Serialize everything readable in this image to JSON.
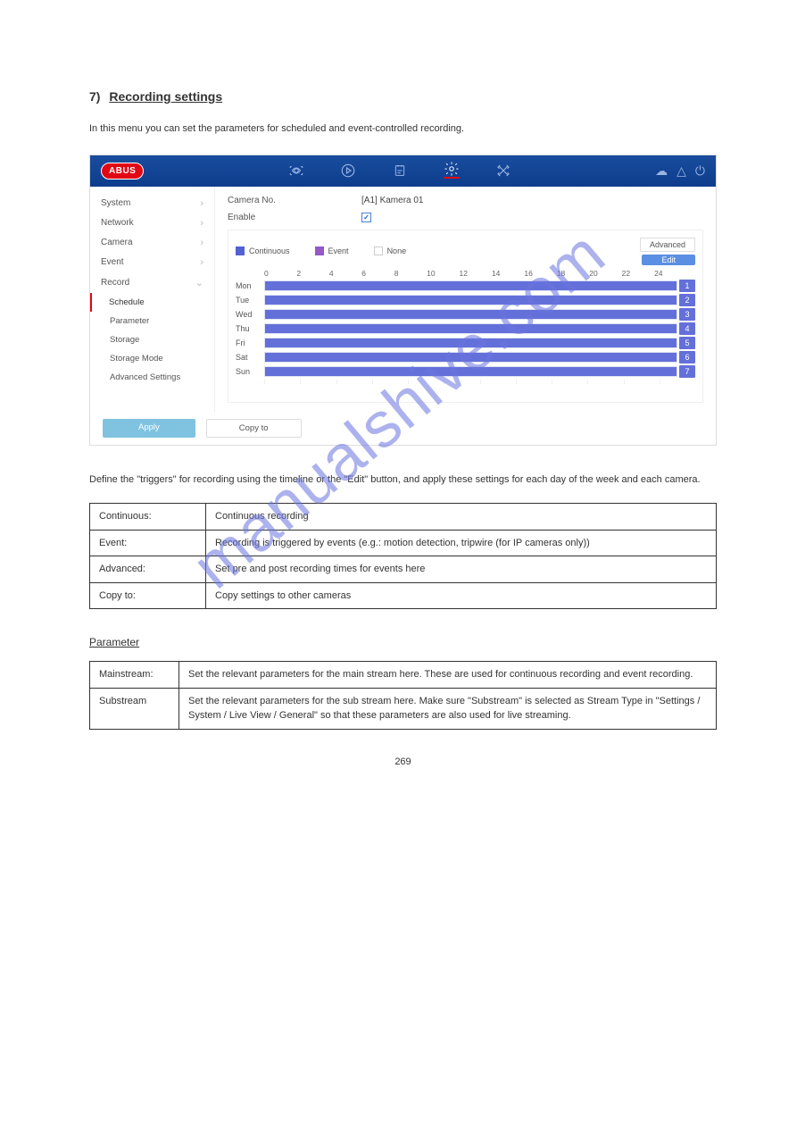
{
  "section": {
    "number": "7)",
    "title": "Recording settings"
  },
  "intro": "In this menu you can set the parameters for scheduled and event-controlled recording.",
  "screenshot": {
    "logo": "ABUS",
    "sidebar": {
      "items": [
        "System",
        "Network",
        "Camera",
        "Event",
        "Record"
      ],
      "subitems": [
        "Schedule",
        "Parameter",
        "Storage",
        "Storage Mode",
        "Advanced Settings"
      ],
      "active_sub": "Schedule"
    },
    "form": {
      "camera_label": "Camera No.",
      "camera_value": "[A1] Kamera 01",
      "enable_label": "Enable"
    },
    "legend": {
      "continuous": "Continuous",
      "event": "Event",
      "none": "None"
    },
    "advanced_btn": "Advanced",
    "edit_btn": "Edit",
    "chart_data": {
      "type": "schedule-gantt",
      "hours": [
        "0",
        "2",
        "4",
        "6",
        "8",
        "10",
        "12",
        "14",
        "16",
        "18",
        "20",
        "22",
        "24"
      ],
      "days": [
        "Mon",
        "Tue",
        "Wed",
        "Thu",
        "Fri",
        "Sat",
        "Sun"
      ],
      "day_nums": [
        "1",
        "2",
        "3",
        "4",
        "5",
        "6",
        "7"
      ],
      "fill": "continuous-full"
    },
    "buttons": {
      "apply": "Apply",
      "copy": "Copy to"
    }
  },
  "para1": "Define the \"triggers\" for recording using the timeline or the \"Edit\" button, and apply these settings for each day of the week and each camera.",
  "table1": {
    "r1c1": "Continuous:",
    "r1c2": "Continuous recording",
    "r2c1": "Event:",
    "r2c2": "Recording is triggered by events (e.g.: motion detection, tripwire (for IP cameras only))",
    "r3c1": "Advanced:",
    "r3c2": "Set pre and post recording times for events here",
    "r4c1": "Copy to:",
    "r4c2": "Copy settings to other cameras"
  },
  "subsection": "Parameter",
  "table2": {
    "r1c1": "Mainstream:",
    "r1c2": "Set the relevant parameters for the main stream here. These are used for continuous recording and event recording.",
    "r2c1": "Substream",
    "r2c2": "Set the relevant parameters for the sub stream here. Make sure \"Substream\" is selected as Stream Type in \"Settings / System / Live View / General\" so that these parameters are also used for live streaming."
  },
  "watermark": "manualshive.com",
  "page_number": "269"
}
